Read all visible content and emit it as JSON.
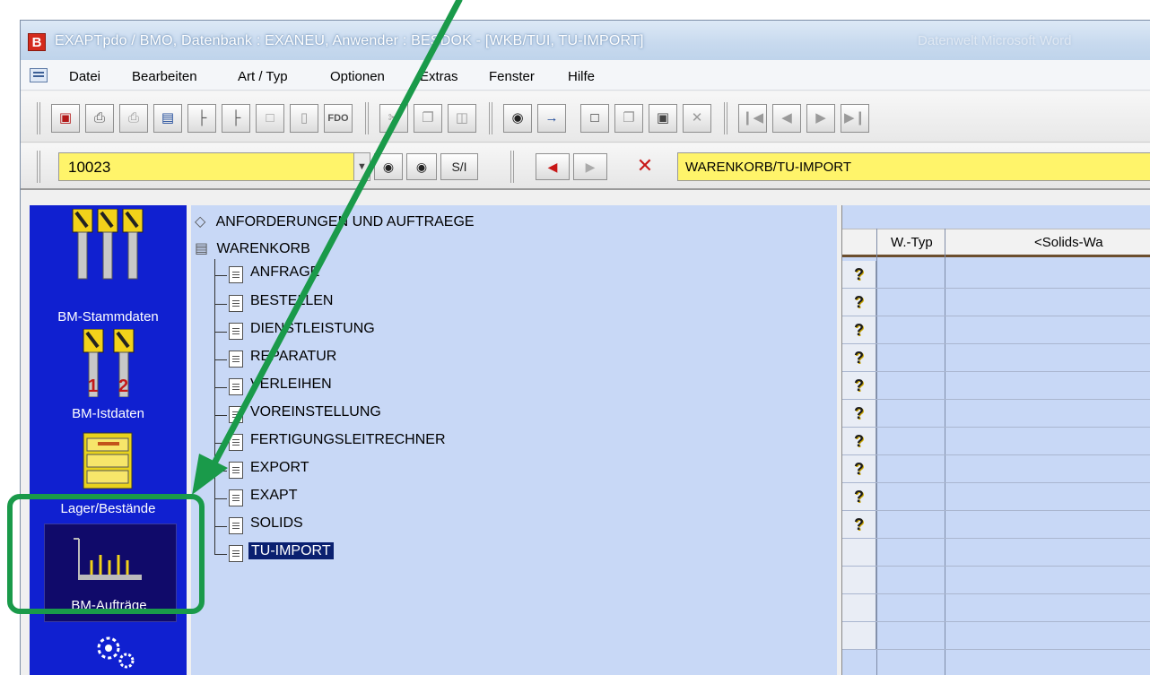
{
  "window": {
    "app_icon": "B",
    "title": "EXAPTpdo / BMO, Datenbank : EXANEU, Anwender : BESDOK - [WKB/TUI, TU-IMPORT]",
    "title_faint": "Datenwelt  Microsoft Word"
  },
  "menu": {
    "items": [
      "Datei",
      "Bearbeiten",
      "Art / Typ",
      "Optionen",
      "Extras",
      "Fenster",
      "Hilfe"
    ]
  },
  "toolbar": {
    "icons": [
      "exit-icon",
      "print-icon",
      "print-preview-icon",
      "view-icon",
      "tree-add-icon",
      "tree-edit-icon",
      "blank-icon",
      "document-edit-icon",
      "fdo-icon",
      "cut-icon",
      "copy-icon",
      "paste-icon",
      "find-icon",
      "find-next-icon",
      "new-icon",
      "duplicate-icon",
      "save-icon",
      "delete-icon",
      "first-record-icon",
      "previous-record-icon",
      "next-record-icon",
      "last-record-icon"
    ],
    "fdo_label": "FDO"
  },
  "navbar": {
    "record_number": "10023",
    "si_label": "S/I",
    "path": "WARENKORB/TU-IMPORT"
  },
  "sidebar": {
    "items": [
      {
        "label": "BM-Stammdaten",
        "icon": "tool-holders-icon"
      },
      {
        "label": "BM-Istdaten",
        "icon": "numbered-tools-icon"
      },
      {
        "label": "Lager/Bestände",
        "icon": "storage-cabinet-icon"
      },
      {
        "label": "BM-Aufträge",
        "icon": "order-cart-icon",
        "active": true
      },
      {
        "label": "",
        "icon": "gears-icon"
      }
    ]
  },
  "tree": {
    "root1": "ANFORDERUNGEN UND AUFTRAEGE",
    "root2": "WARENKORB",
    "children": [
      "ANFRAGE",
      "BESTELLEN",
      "DIENSTLEISTUNG",
      "REPARATUR",
      "VERLEIHEN",
      "VOREINSTELLUNG",
      "FERTIGUNGSLEITRECHNER",
      "EXPORT",
      "EXAPT",
      "SOLIDS",
      "TU-IMPORT"
    ],
    "selected": "TU-IMPORT"
  },
  "grid": {
    "columns": [
      "W.-Typ",
      "<Solids-Wa"
    ],
    "row_markers": [
      "?",
      "?",
      "?",
      "?",
      "?",
      "?",
      "?",
      "?",
      "?",
      "?"
    ]
  },
  "colors": {
    "sidebar_bg": "#1020d0",
    "highlight": "#1a9a4a",
    "field_yellow": "#fff46a",
    "selection": "#0a2070"
  }
}
